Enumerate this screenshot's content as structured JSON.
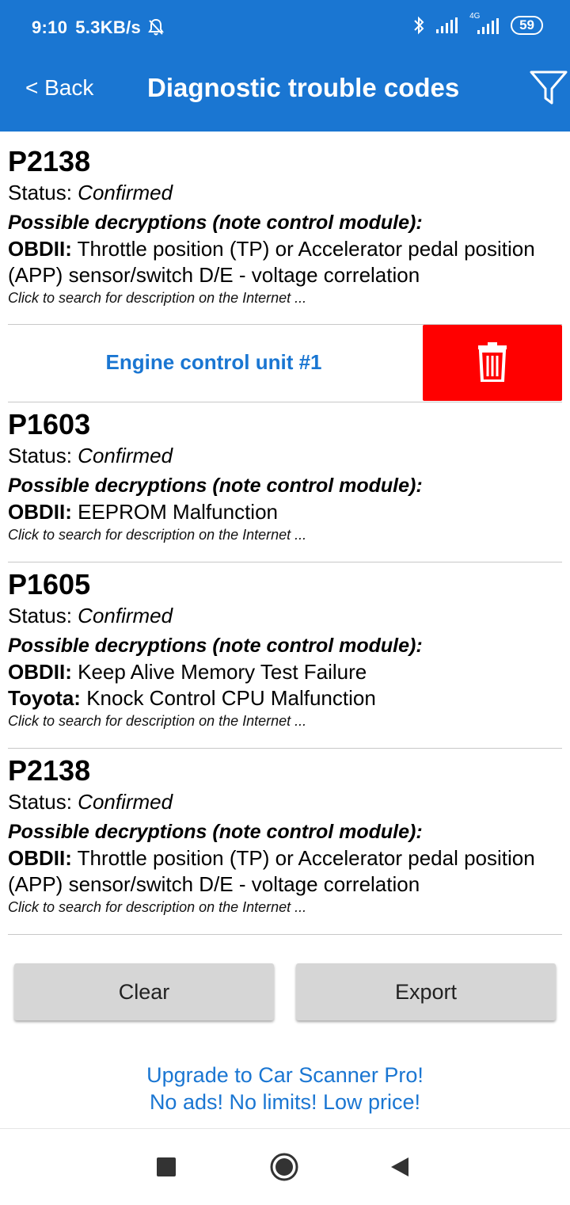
{
  "status_bar": {
    "time": "9:10",
    "speed": "5.3KB/s",
    "battery": "59",
    "net_type": "4G",
    "icons": [
      "mute-bell-icon",
      "bluetooth-icon",
      "signal-icon",
      "signal-4g-icon",
      "battery-icon"
    ]
  },
  "header": {
    "back_label": "< Back",
    "title": "Diagnostic trouble codes",
    "filter_icon": "filter-icon",
    "color": "#1a76d2"
  },
  "dtcs": [
    {
      "code": "P2138",
      "status_label": "Status:",
      "status": "Confirmed",
      "possible_label": "Possible decryptions (note control module):",
      "lines": [
        {
          "source": "OBDII:",
          "text": "Throttle position (TP) or Accelerator pedal position (APP) sensor/switch D/E - voltage correlation"
        }
      ],
      "search_hint": "Click to search for description on the Internet ..."
    },
    {
      "code": "P1603",
      "status_label": "Status:",
      "status": "Confirmed",
      "possible_label": "Possible decryptions (note control module):",
      "lines": [
        {
          "source": "OBDII:",
          "text": "EEPROM Malfunction"
        }
      ],
      "search_hint": "Click to search for description on the Internet ..."
    },
    {
      "code": "P1605",
      "status_label": "Status:",
      "status": "Confirmed",
      "possible_label": "Possible decryptions (note control module):",
      "lines": [
        {
          "source": "OBDII:",
          "text": "Keep Alive Memory Test Failure"
        },
        {
          "source": "Toyota:",
          "text": "Knock Control CPU Malfunction"
        }
      ],
      "search_hint": "Click to search for description on the Internet ..."
    },
    {
      "code": "P2138",
      "status_label": "Status:",
      "status": "Confirmed",
      "possible_label": "Possible decryptions (note control module):",
      "lines": [
        {
          "source": "OBDII:",
          "text": "Throttle position (TP) or Accelerator pedal position (APP) sensor/switch D/E - voltage correlation"
        }
      ],
      "search_hint": "Click to search for description on the Internet ..."
    }
  ],
  "ecu_row": {
    "label": "Engine control unit #1",
    "delete_icon": "trash-icon",
    "delete_color": "#ff0000"
  },
  "actions": {
    "clear_label": "Clear",
    "export_label": "Export"
  },
  "promo": {
    "line1": "Upgrade to Car Scanner Pro!",
    "line2": "No ads! No limits! Low price!"
  },
  "nav": {
    "icons": [
      "recent-apps-icon",
      "home-icon",
      "back-icon"
    ]
  }
}
